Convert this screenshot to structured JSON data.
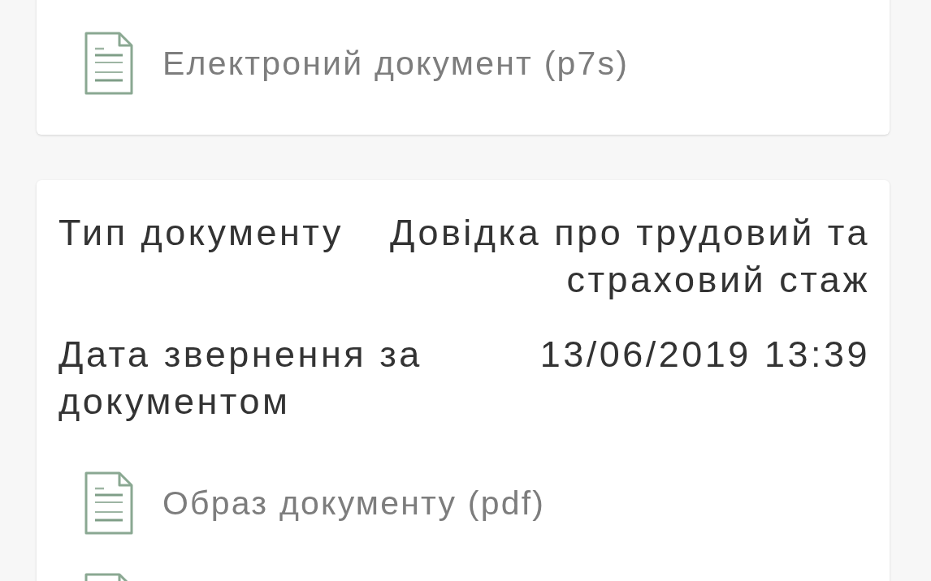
{
  "cards": [
    {
      "files": [
        {
          "kind": "file",
          "label": "Електроний документ (p7s)"
        }
      ]
    },
    {
      "fields": [
        {
          "label": "Тип документу",
          "value": "Довідка про трудовий та страховий стаж"
        },
        {
          "label": "Дата звернення за документом",
          "value": "13/06/2019 13:39"
        }
      ],
      "files": [
        {
          "kind": "file",
          "label": "Образ документу (pdf)"
        },
        {
          "kind": "file"
        }
      ]
    }
  ]
}
